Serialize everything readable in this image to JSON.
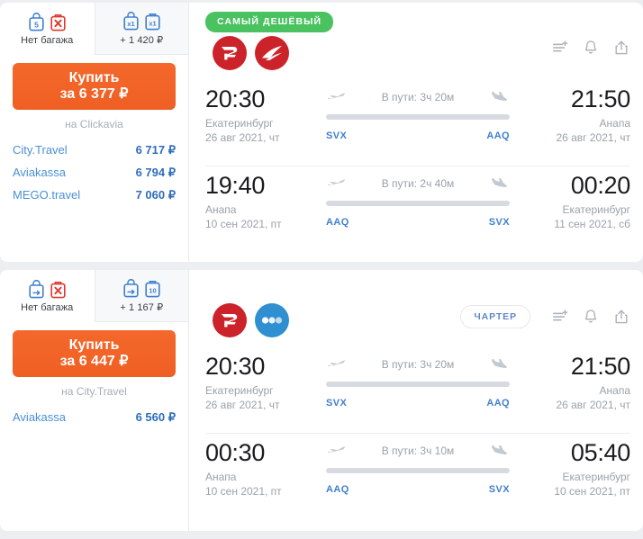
{
  "cards": [
    {
      "baggage_tabs": [
        {
          "label": "Нет багажа",
          "active": true,
          "handbag_text": "5",
          "suitcase_text": "X",
          "suitcase_type": "none"
        },
        {
          "label": "+ 1 420 ₽",
          "active": false,
          "handbag_text": "x1",
          "suitcase_text": "x1",
          "suitcase_type": "included"
        }
      ],
      "buy_button": {
        "line1": "Купить",
        "line2": "за 6 377 ₽"
      },
      "buy_on": "на Clickavia",
      "agencies": [
        {
          "name": "City.Travel",
          "price": "6 717 ₽"
        },
        {
          "name": "Aviakassa",
          "price": "6 794 ₽"
        },
        {
          "name": "MEGO.travel",
          "price": "7 060 ₽"
        }
      ],
      "badge": {
        "text": "САМЫЙ ДЕШЁВЫЙ",
        "type": "cheapest"
      },
      "airlines": [
        "rossiya-logo",
        "aeroflot-logo"
      ],
      "segments": [
        {
          "depart_time": "20:30",
          "depart_city": "Екатеринбург",
          "depart_date": "26 авг 2021, чт",
          "depart_code": "SVX",
          "duration": "В пути: 3ч 20м",
          "arrive_time": "21:50",
          "arrive_city": "Анапа",
          "arrive_date": "26 авг 2021, чт",
          "arrive_code": "AAQ"
        },
        {
          "depart_time": "19:40",
          "depart_city": "Анапа",
          "depart_date": "10 сен 2021, пт",
          "depart_code": "AAQ",
          "duration": "В пути: 2ч 40м",
          "arrive_time": "00:20",
          "arrive_city": "Екатеринбург",
          "arrive_date": "11 сен 2021, сб",
          "arrive_code": "SVX"
        }
      ]
    },
    {
      "baggage_tabs": [
        {
          "label": "Нет багажа",
          "active": true,
          "handbag_text": "arrow",
          "suitcase_text": "X",
          "suitcase_type": "none"
        },
        {
          "label": "+ 1 167 ₽",
          "active": false,
          "handbag_text": "arrow",
          "suitcase_text": "10",
          "suitcase_type": "included"
        }
      ],
      "buy_button": {
        "line1": "Купить",
        "line2": "за 6 447 ₽"
      },
      "buy_on": "на City.Travel",
      "agencies": [
        {
          "name": "Aviakassa",
          "price": "6 560 ₽"
        }
      ],
      "badge": {
        "text": "ЧАРТЕР",
        "type": "charter"
      },
      "airlines": [
        "rossiya-logo",
        "dots-logo"
      ],
      "segments": [
        {
          "depart_time": "20:30",
          "depart_city": "Екатеринбург",
          "depart_date": "26 авг 2021, чт",
          "depart_code": "SVX",
          "duration": "В пути: 3ч 20м",
          "arrive_time": "21:50",
          "arrive_city": "Анапа",
          "arrive_date": "26 авг 2021, чт",
          "arrive_code": "AAQ"
        },
        {
          "depart_time": "00:30",
          "depart_city": "Анапа",
          "depart_date": "10 сен 2021, пт",
          "depart_code": "AAQ",
          "duration": "В пути: 3ч 10м",
          "arrive_time": "05:40",
          "arrive_city": "Екатеринбург",
          "arrive_date": "10 сен 2021, пт",
          "arrive_code": "SVX"
        }
      ]
    }
  ],
  "action_icons": [
    "compare-icon",
    "bell-icon",
    "share-icon"
  ],
  "colors": {
    "buy_button": "#ef5f23",
    "badge_cheapest": "#49c25f",
    "badge_charter_text": "#5d87c4",
    "agency_link": "#4b8fd6",
    "agency_price": "#2f6dbb",
    "airport_code": "#3f7fd0",
    "baggage_blue": "#3f7fd0",
    "baggage_red": "#e0352b",
    "rossiya_red": "#cc2229",
    "dots_blue": "#2f8fd0"
  }
}
